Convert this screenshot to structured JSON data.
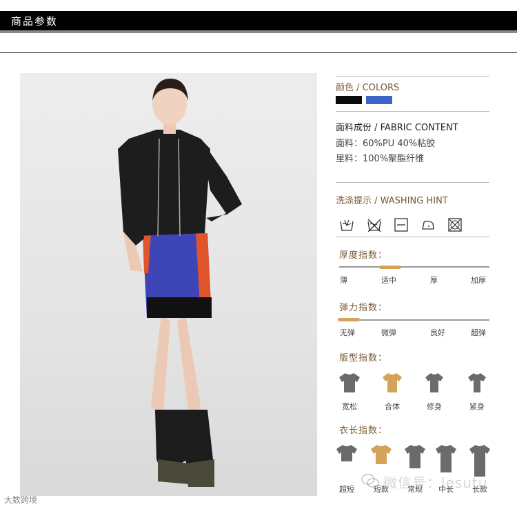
{
  "header": {
    "title": "商品参数"
  },
  "colors": {
    "title": "颜色 / COLORS",
    "swatches": [
      "#0a0a0a",
      "#3a64c8"
    ]
  },
  "fabric": {
    "title": "面料成份 / FABRIC CONTENT",
    "lines": [
      "面料：60%PU  40%粘胶",
      "里料：100%聚酯纤维"
    ]
  },
  "washing": {
    "title": "洗涤提示 / WASHING HINT",
    "icons": [
      "hand-wash-icon",
      "no-wash-icon",
      "no-tumble-dry-icon",
      "low-iron-icon",
      "no-dry-clean-icon"
    ]
  },
  "thickness": {
    "title": "厚度指数：",
    "labels": [
      "薄",
      "适中",
      "厚",
      "加厚"
    ],
    "selected": "适中"
  },
  "elasticity": {
    "title": "弹力指数：",
    "labels": [
      "无弹",
      "微弹",
      "良好",
      "超弹"
    ],
    "selected": "无弹"
  },
  "fit": {
    "title": "版型指数：",
    "labels": [
      "宽松",
      "合体",
      "修身",
      "紧身"
    ],
    "selected": "合体"
  },
  "length": {
    "title": "衣长指数：",
    "labels": [
      "超短",
      "短款",
      "常规",
      "中长",
      "长款"
    ],
    "selected": "短款"
  },
  "watermark": {
    "right": "微信号：lesutu",
    "left": "大数跨境"
  },
  "accent": "#d4a259"
}
